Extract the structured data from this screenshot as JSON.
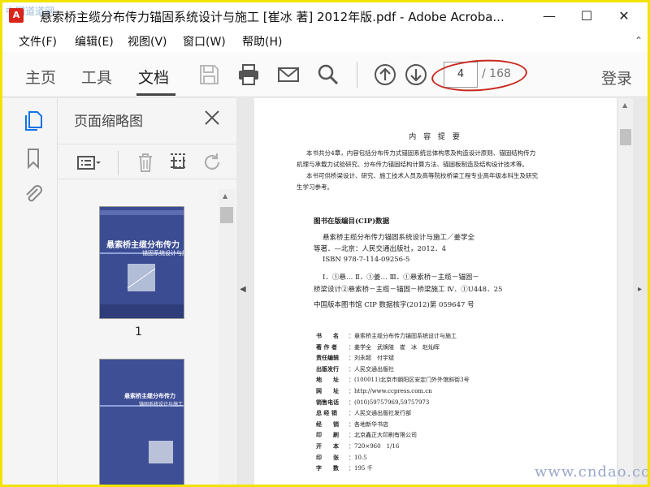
{
  "window": {
    "title": "悬索桥主缆分布传力锚固系统设计与施工 [崔冰 著] 2012年版.pdf - Adobe Acroba...",
    "app_icon_letter": "A",
    "controls": {
      "minimize": "—",
      "maximize": "☐",
      "close": "✕"
    },
    "corner_logo": "中国道道网"
  },
  "menu": {
    "items": [
      "文件(F)",
      "编辑(E)",
      "视图(V)",
      "窗口(W)",
      "帮助(H)"
    ],
    "collapse": "⌃"
  },
  "toolbar": {
    "tabs": [
      {
        "label": "主页",
        "active": false
      },
      {
        "label": "工具",
        "active": false
      },
      {
        "label": "文档",
        "active": true
      }
    ],
    "icons": [
      "save-icon",
      "print-icon",
      "email-icon",
      "search-icon",
      "page-up-icon",
      "page-down-icon"
    ],
    "page_number": "4",
    "page_total": "/ 168",
    "login": "登录",
    "annotation_color": "#c8281e"
  },
  "rail": {
    "icons": [
      "page-thumbnails-icon",
      "bookmark-icon",
      "attachment-icon"
    ],
    "active_color": "#1473e6"
  },
  "thumbnail_panel": {
    "title": "页面缩略图",
    "tools": [
      "page-options-icon",
      "delete-page-icon",
      "extract-page-icon",
      "rotate-page-icon"
    ],
    "thumbnails": [
      {
        "page_label": "1",
        "cover_title": "悬索桥主缆分布传力",
        "cover_subtitle": "锚固系统设计与施工"
      },
      {
        "page_label": "",
        "cover_title": "悬索桥主缆分布传力",
        "cover_subtitle": "锚固系统设计与施工"
      }
    ]
  },
  "document": {
    "heading": "内 容 提 要",
    "summary_lines": [
      "本书共分4章，内容包括分布传力式锚固系统总体构思及构造设计原则、锚固结构传力",
      "机理与承载力试验研究、分布传力锚固结构计算方法、锚固板制造及结构设计技术等。",
      "本书可供桥梁设计、研究、施工技术人员及高等院校桥梁工程专业高年级本科生及研究",
      "生学习参考。"
    ],
    "cip_heading": "图书在版编目(CIP)数据",
    "cip_lines": [
      "悬索桥主缆分布传力锚固系统设计与施工／姜学全",
      "等著．—北京：人民交通出版社，2012．4",
      "ISBN 978-7-114-09256-5",
      "Ⅰ．①悬…  Ⅱ．①姜…  Ⅲ．①悬索桥－主缆－锚固－",
      "桥梁设计②悬索桥－主缆－锚固－桥梁施工  Ⅳ．①U448．25",
      "中国版本图书馆 CIP 数据核字(2012)第 059647 号"
    ],
    "colophon": [
      {
        "label": "书　　名",
        "value": "：悬索桥主缆分布传力锚固系统设计与施工"
      },
      {
        "label": "著 作 者",
        "value": "：姜学全　武焕陵　崔　冰　赵灿晖"
      },
      {
        "label": "责任编辑",
        "value": "：刘永超　付宇斌"
      },
      {
        "label": "出版发行",
        "value": "：人民交通出版社"
      },
      {
        "label": "地　　址",
        "value": "：(100011)北京市朝阳区安定门外外馆斜街3号"
      },
      {
        "label": "网　　址",
        "value": "：http://www.ccpress.com.cn"
      },
      {
        "label": "销售电话",
        "value": "：(010)59757969,59757973"
      },
      {
        "label": "总 经 销",
        "value": "：人民交通出版社发行部"
      },
      {
        "label": "经　　销",
        "value": "：各地新华书店"
      },
      {
        "label": "印　　刷",
        "value": "：北京鑫正大印刷有限公司"
      },
      {
        "label": "开　　本",
        "value": "：720×960　1/16"
      },
      {
        "label": "印　　张",
        "value": "：10.5"
      },
      {
        "label": "字　　数",
        "value": "：195 千"
      }
    ]
  },
  "watermark": "www.cndao.com"
}
